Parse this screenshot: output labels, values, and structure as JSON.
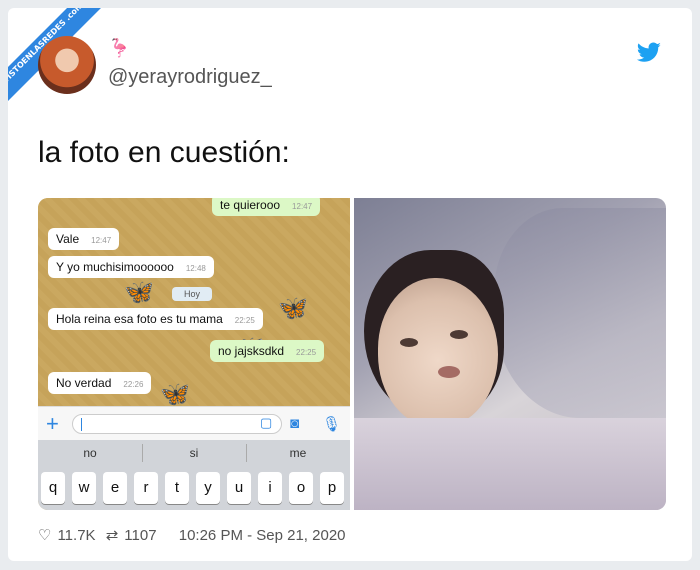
{
  "watermark": "VISTOENLASREDES .com",
  "author": {
    "handle": "@yerayrodriguez_",
    "emoji": "🦩"
  },
  "tweet_text": "la foto en cuestión:",
  "chat": {
    "messages": [
      {
        "dir": "out",
        "text": "te quierooo",
        "time": "12:47"
      },
      {
        "dir": "in",
        "text": "Vale",
        "time": "12:47"
      },
      {
        "dir": "in",
        "text": "Y yo muchisimoooooo",
        "time": "12:48"
      },
      {
        "dir": "in",
        "text": "Hola reina esa foto es tu mama",
        "time": "22:25"
      },
      {
        "dir": "out",
        "text": "no jajsksdkd",
        "time": "22:25"
      },
      {
        "dir": "in",
        "text": "No verdad",
        "time": "22:26"
      }
    ],
    "day_label": "Hoy",
    "suggestions": [
      "no",
      "si",
      "me"
    ],
    "keys": [
      "q",
      "w",
      "e",
      "r",
      "t",
      "y",
      "u",
      "i",
      "o",
      "p"
    ]
  },
  "stats": {
    "likes": "11.7K",
    "retweets": "1107",
    "timestamp": "10:26 PM - Sep 21, 2020"
  },
  "colors": {
    "twitter_blue": "#1da1f2",
    "outgoing_bubble": "#dcf8c6",
    "ribbon": "#2e86e0"
  },
  "icons": [
    "heart-icon",
    "retweet-icon",
    "twitter-bird-icon",
    "plus-icon",
    "sticker-icon",
    "camera-icon",
    "microphone-icon"
  ]
}
